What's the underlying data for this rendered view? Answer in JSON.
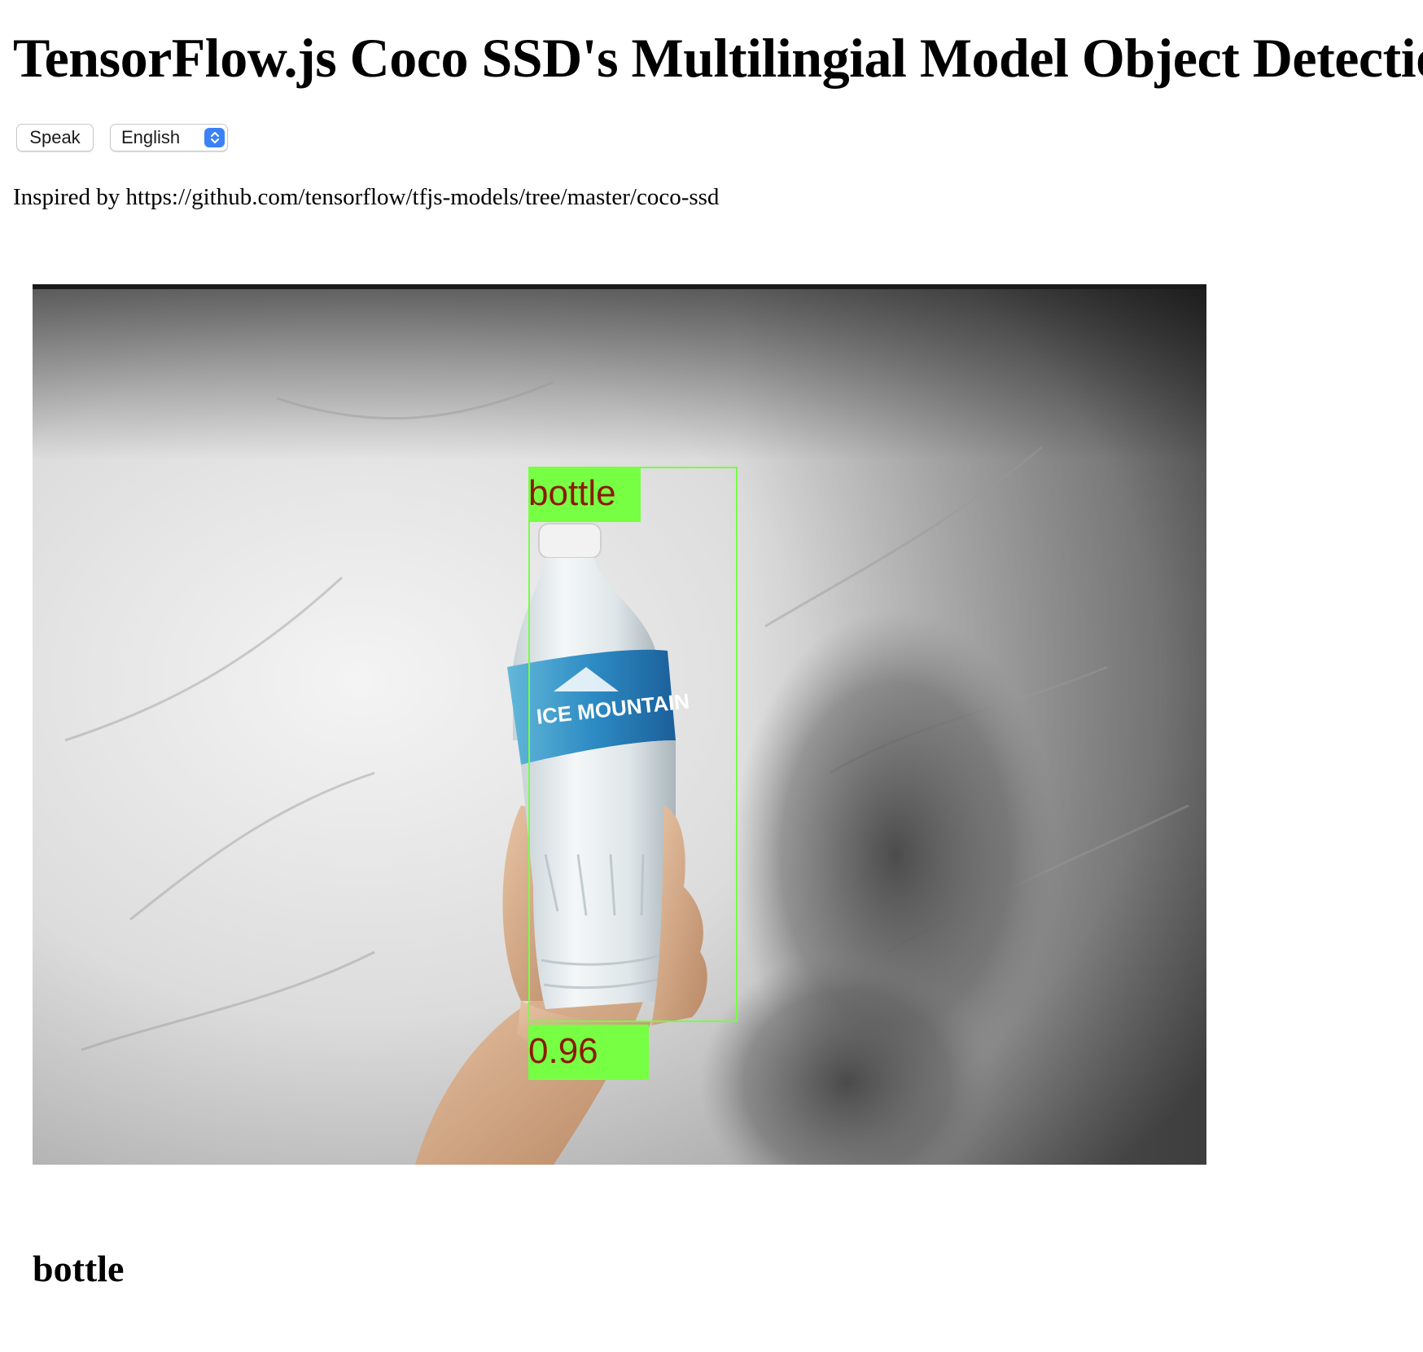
{
  "page": {
    "title": "TensorFlow.js Coco SSD's Multilingial Model Object Detection",
    "inspired_text": "Inspired by https://github.com/tensorflow/tfjs-models/tree/master/coco-ssd"
  },
  "controls": {
    "speak_label": "Speak",
    "language_selected": "English",
    "stepper_color": "#3b82f6"
  },
  "video": {
    "scene": "hand holding a water bottle in front of a white sheet",
    "bottle_label_text": "ICE MOUNTAIN"
  },
  "detection": {
    "class_label": "bottle",
    "score": "0.96",
    "box_color": "#77ff44",
    "label_text_color": "#8b1a00"
  },
  "result": {
    "detected_name": "bottle"
  }
}
